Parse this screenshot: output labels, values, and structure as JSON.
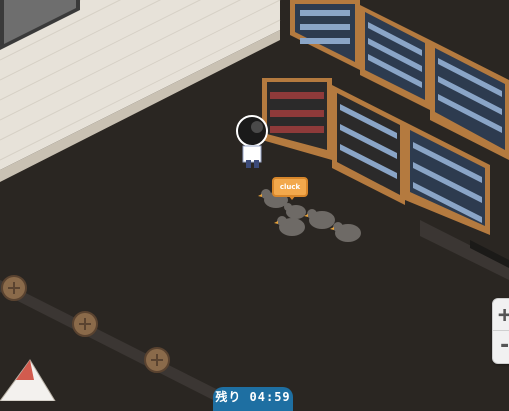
{
  "scene": {
    "speech_bubble": "cluck",
    "timer_text": "残り 04:59"
  },
  "controls": {
    "zoom_in_label": "+",
    "zoom_out_label": "-"
  },
  "colors": {
    "floor": "#2a2622",
    "wall": "#e7e2d9",
    "shelf_wood": "#b47a3f",
    "timer_bg": "#1e6fa2",
    "bubble": "#f2a84c"
  },
  "icons": [
    "bookshelf-icon",
    "chicken-icon",
    "player-avatar-icon",
    "stool-icon",
    "tent-icon"
  ]
}
